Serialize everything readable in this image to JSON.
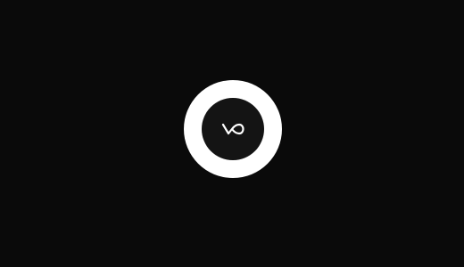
{
  "app": {
    "background_color": "#0a0a0a"
  },
  "center_button": {
    "icon": "infinity-icon",
    "ring_color": "#ffffff",
    "core_color": "#141414",
    "icon_color": "#ffffff"
  }
}
